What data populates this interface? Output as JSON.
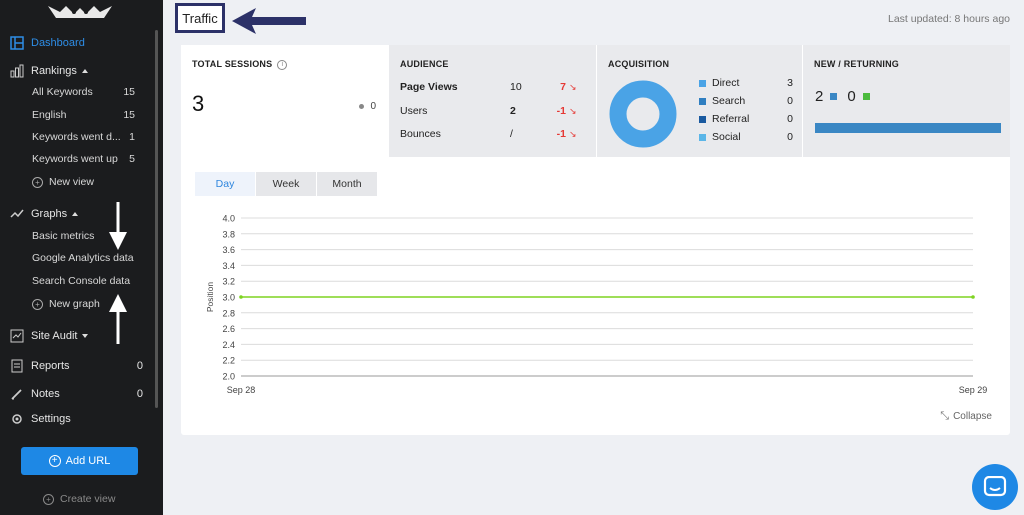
{
  "sidebar": {
    "dashboard": "Dashboard",
    "rankings": {
      "label": "Rankings",
      "items": [
        {
          "label": "All Keywords",
          "count": "15"
        },
        {
          "label": "English",
          "count": "15"
        },
        {
          "label": "Keywords went d...",
          "count": "1"
        },
        {
          "label": "Keywords went up",
          "count": "5"
        }
      ],
      "new_view": "New view"
    },
    "graphs": {
      "label": "Graphs",
      "items": [
        "Basic metrics",
        "Google Analytics data",
        "Search Console data"
      ],
      "new_graph": "New graph"
    },
    "site_audit": "Site Audit",
    "reports": {
      "label": "Reports",
      "count": "0"
    },
    "notes": {
      "label": "Notes",
      "count": "0"
    },
    "settings": "Settings",
    "add_url": "Add URL",
    "create_view": "Create view"
  },
  "header": {
    "title": "Traffic",
    "last_updated": "Last updated: 8 hours ago"
  },
  "total_sessions": {
    "title": "TOTAL SESSIONS",
    "info": "i",
    "value": "3",
    "secondary": "0"
  },
  "audience": {
    "title": "AUDIENCE",
    "rows": [
      {
        "label": "Page Views",
        "value": "10",
        "change": "7",
        "arrow": "↘"
      },
      {
        "label": "Users",
        "value": "2",
        "change": "-1",
        "arrow": "↘"
      },
      {
        "label": "Bounces",
        "value": "/",
        "change": "-1",
        "arrow": "↘"
      }
    ]
  },
  "acquisition": {
    "title": "ACQUISITION",
    "rows": [
      {
        "label": "Direct",
        "value": "3",
        "color": "#4aa3e6"
      },
      {
        "label": "Search",
        "value": "0",
        "color": "#2f7fc1"
      },
      {
        "label": "Referral",
        "value": "0",
        "color": "#1a5aa0"
      },
      {
        "label": "Social",
        "value": "0",
        "color": "#5bb6e8"
      }
    ],
    "donut_color": "#4aa3e6"
  },
  "new_returning": {
    "title": "NEW / RETURNING",
    "new_value": "2",
    "returning_value": "0",
    "new_color": "#3a87c4",
    "returning_color": "#4cbb3e",
    "new_share": 1.0
  },
  "tabs": {
    "day": "Day",
    "week": "Week",
    "month": "Month",
    "active": "Day"
  },
  "collapse": "Collapse",
  "chart_data": {
    "type": "line",
    "x": [
      "Sep 28",
      "Sep 29"
    ],
    "series": [
      {
        "values": [
          3.0,
          3.0
        ],
        "color": "#7ed321"
      }
    ],
    "ylabel": "Position",
    "ylim": [
      2.0,
      4.0
    ],
    "yticks": [
      "2.0",
      "2.2",
      "2.4",
      "2.6",
      "2.8",
      "3.0",
      "3.2",
      "3.4",
      "3.6",
      "3.8",
      "4.0"
    ],
    "grid": true
  }
}
